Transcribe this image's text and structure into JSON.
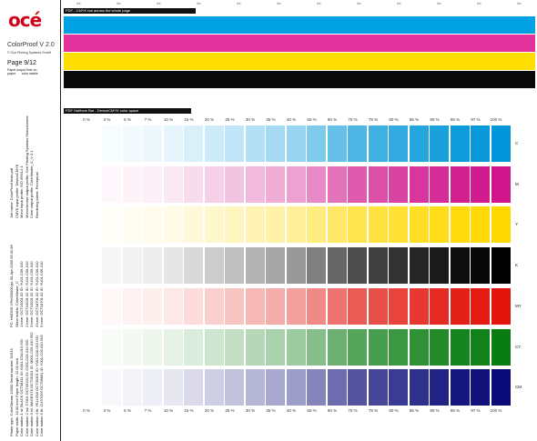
{
  "sidebar": {
    "logo_text": "océ",
    "app_name": "ColorProof V 2.0",
    "copyright": "© Océ Printing Systems GmbH",
    "page_label": "Page 9/12",
    "paper_output": "Paper output time on\npaper       color stable",
    "info_block_1": [
      "Job name: ColorProof tests.pdf",
      "CMYK input profile:         DeviceCMYK",
      "Mono input profile:         ISO 3664-2:1",
      "Monochrome output profile: Océ Printing Systems Monochrome",
      "Color output profile:       ColorMaster_C_V 3.1",
      "Rendering intent:           Perceptual"
    ],
    "info_block_2": [
      "PC: HMODE     VPe000000.jsc  30-Apr-2009 09:41:36",
      "Skew matrix: ColorMaster_C",
      "1 tone: OCT10001.02  ID: YU01-C06-010",
      "2 tone: OCT10031.02  ID: YU01-C06-010",
      "3 tone: OCT10031.02  ID: YU01-C06-010",
      "4 tone: OCT18701.02  ID: YU01-C06-010",
      "5 tone: OCT18701.02  ID: YU01-C06-010"
    ],
    "info_block_3": [
      "Printer type: ColorStream 10000     Serial number: 61015",
      "Paper width: 19.00 inch             Paper length: 12.00 inch",
      "Color station 1 st: BLACK OCT08411  ID: K001-C04-010 ISO",
      "Color station 2 nd: CYAN OCT05201  ID: C001-C05-010 ISO",
      "Color station 3 rd: MAGENTA OCT05101  ID: M001-C05-010 ISO",
      "Color station 4 th: YELLOW OCT05301  ID: Y001-C05-010 ISO",
      "Color station 5 th: CUSTOM OCT08801  ID: Y001-C05-010 ISO"
    ]
  },
  "cmyk_section": {
    "label": "PDF - CMYK bar across the whole page",
    "bars": [
      {
        "name": "cyan",
        "color": "#00a0e3"
      },
      {
        "name": "magenta",
        "color": "#e2319b"
      },
      {
        "name": "yellow",
        "color": "#ffdd00"
      },
      {
        "name": "black",
        "color": "#0a0a0a"
      }
    ]
  },
  "halftone_section": {
    "label": "PDF Halftone Bar - DeviceCMYK color space",
    "percentages": [
      "0 %",
      "3 %",
      "5 %",
      "7 %",
      "10 %",
      "15 %",
      "20 %",
      "25 %",
      "30 %",
      "35 %",
      "40 %",
      "50 %",
      "60 %",
      "70 %",
      "75 %",
      "80 %",
      "85 %",
      "90 %",
      "95 %",
      "97 %",
      "100 %"
    ],
    "tints": [
      0,
      3,
      5,
      7,
      10,
      15,
      20,
      25,
      30,
      35,
      40,
      50,
      60,
      70,
      75,
      80,
      85,
      90,
      95,
      97,
      100
    ],
    "ramps": [
      {
        "label": "C",
        "color": "#0096d9"
      },
      {
        "label": "M",
        "color": "#d0148b"
      },
      {
        "label": "Y",
        "color": "#ffd800"
      },
      {
        "label": "K",
        "color": "#000000"
      },
      {
        "label": "MY",
        "color": "#e2140c"
      },
      {
        "label": "CY",
        "color": "#0a7d12"
      },
      {
        "label": "CM",
        "color": "#0a0a78"
      }
    ]
  }
}
